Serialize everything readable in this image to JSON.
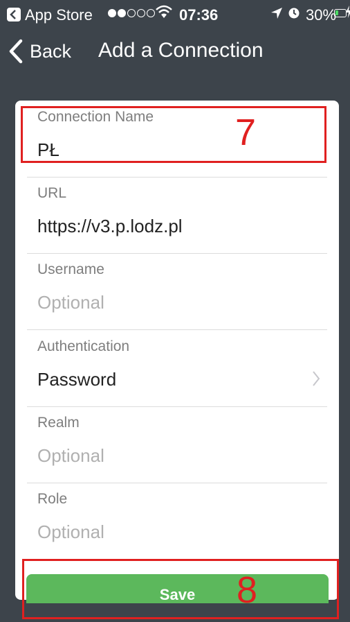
{
  "status_bar": {
    "app_label": "App Store",
    "signal": [
      true,
      true,
      false,
      false,
      false
    ],
    "time": "07:36",
    "battery_percent": "30%",
    "battery_level": 0.3
  },
  "nav": {
    "back_label": "Back",
    "title": "Add a Connection"
  },
  "form": {
    "fields": [
      {
        "label": "Connection Name",
        "value": "PŁ",
        "is_placeholder": false
      },
      {
        "label": "URL",
        "value": "https://v3.p.lodz.pl",
        "is_placeholder": false
      },
      {
        "label": "Username",
        "value": "Optional",
        "is_placeholder": true
      },
      {
        "label": "Authentication",
        "value": "Password",
        "is_placeholder": false,
        "has_chevron": true
      },
      {
        "label": "Realm",
        "value": "Optional",
        "is_placeholder": true
      },
      {
        "label": "Role",
        "value": "Optional",
        "is_placeholder": true
      }
    ],
    "save_label": "Save"
  },
  "annotations": [
    "7",
    "8"
  ],
  "colors": {
    "background": "#3d444b",
    "save_button": "#5cb85c",
    "annotation": "#e02020"
  }
}
